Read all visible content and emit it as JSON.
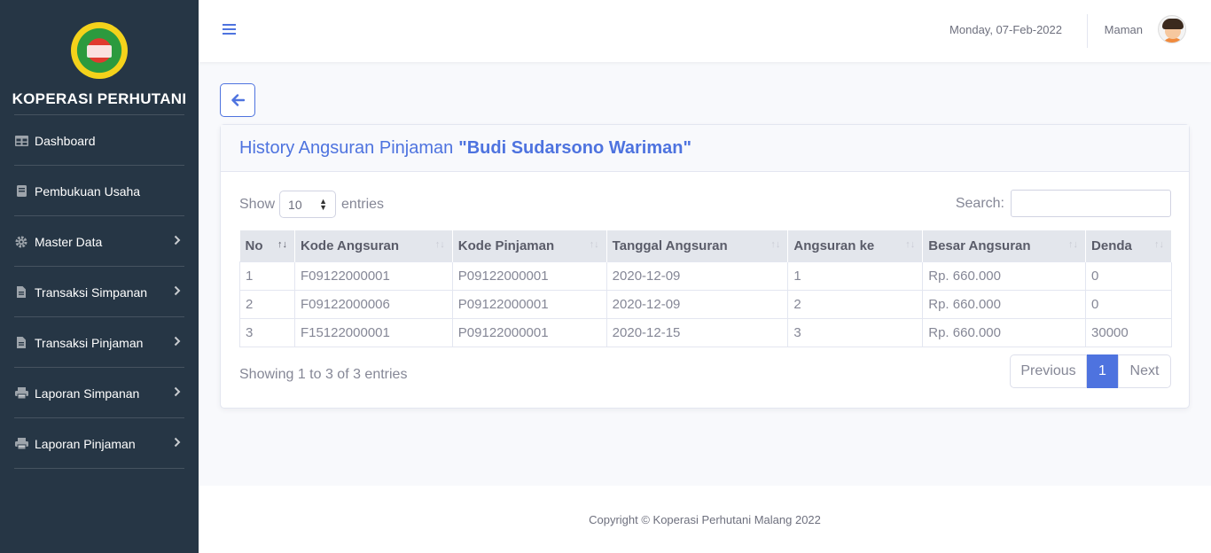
{
  "sidebar": {
    "brand": "KOPERASI PERHUTANI",
    "items": [
      {
        "label": "Dashboard",
        "icon": "table-icon"
      },
      {
        "label": "Pembukuan Usaha",
        "icon": "book-icon"
      },
      {
        "label": "Master Data",
        "icon": "gear-icon"
      },
      {
        "label": "Transaksi Simpanan",
        "icon": "file-icon"
      },
      {
        "label": "Transaksi Pinjaman",
        "icon": "file-icon"
      },
      {
        "label": "Laporan Simpanan",
        "icon": "print-icon"
      },
      {
        "label": "Laporan Pinjaman",
        "icon": "print-icon"
      }
    ]
  },
  "topbar": {
    "date": "Monday, 07-Feb-2022",
    "user": "Maman"
  },
  "card": {
    "title": "History Angsuran Pinjaman",
    "name": "\"Budi Sudarsono Wariman\""
  },
  "table_controls": {
    "show_label": "Show",
    "entries_value": "10",
    "entries_label": "entries",
    "search_label": "Search:",
    "search_value": ""
  },
  "table": {
    "columns": [
      "No",
      "Kode Angsuran",
      "Kode Pinjaman",
      "Tanggal Angsuran",
      "Angsuran ke",
      "Besar Angsuran",
      "Denda"
    ],
    "rows": [
      [
        "1",
        "F09122000001",
        "P09122000001",
        "2020-12-09",
        "1",
        "Rp. 660.000",
        "0"
      ],
      [
        "2",
        "F09122000006",
        "P09122000001",
        "2020-12-09",
        "2",
        "Rp. 660.000",
        "0"
      ],
      [
        "3",
        "F15122000001",
        "P09122000001",
        "2020-12-15",
        "3",
        "Rp. 660.000",
        "30000"
      ]
    ]
  },
  "pagination": {
    "info": "Showing 1 to 3 of 3 entries",
    "previous": "Previous",
    "current": "1",
    "next": "Next"
  },
  "footer": {
    "text": "Copyright © Koperasi Perhutani Malang 2022"
  },
  "colors": {
    "sidebar": "#263645",
    "primary": "#4e73df",
    "background": "#f8f9fc"
  }
}
